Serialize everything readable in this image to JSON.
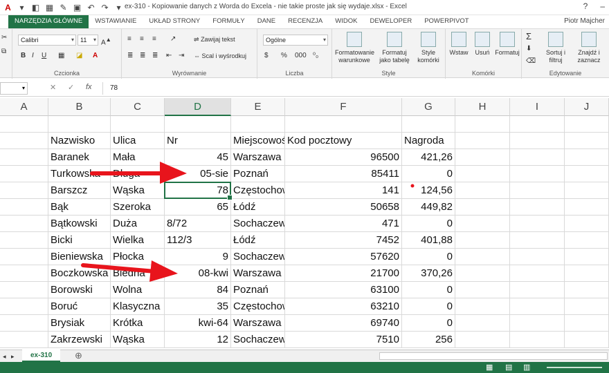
{
  "window": {
    "title": "ex-310 - Kopiowanie danych z Worda do Excela - nie takie proste jak się wydaje.xlsx - Excel",
    "user": "Piotr Majcher"
  },
  "tabs": [
    "NARZĘDZIA GŁÓWNE",
    "WSTAWIANIE",
    "UKŁAD STRONY",
    "FORMUŁY",
    "DANE",
    "RECENZJA",
    "WIDOK",
    "DEWELOPER",
    "POWERPIVOT"
  ],
  "ribbon": {
    "font_name": "Calibri",
    "font_size": "11",
    "number_format": "Ogólne",
    "wrap_text": "Zawijaj tekst",
    "merge_center": "Scal i wyśrodkuj",
    "cond_format": "Formatowanie warunkowe",
    "format_table": "Formatuj jako tabelę",
    "cell_styles": "Style komórki",
    "insert": "Wstaw",
    "delete": "Usuń",
    "format": "Formatuj",
    "sort_filter": "Sortuj i filtruj",
    "find_select": "Znajdź i zaznacz",
    "groups": {
      "font": "Czcionka",
      "alignment": "Wyrównanie",
      "number": "Liczba",
      "style": "Style",
      "cells": "Komórki",
      "editing": "Edytowanie"
    }
  },
  "formula_bar": {
    "value": "78"
  },
  "columns": [
    "A",
    "B",
    "C",
    "D",
    "E",
    "F",
    "G",
    "H",
    "I",
    "J"
  ],
  "headers": {
    "B": "Nazwisko",
    "C": "Ulica",
    "D": "Nr",
    "E": "Miejscowość",
    "F": "Kod pocztowy",
    "G": "Nagroda"
  },
  "rows": [
    [
      "Baranek",
      "Mała",
      "45",
      "Warszawa",
      "96500",
      "421,26"
    ],
    [
      "Turkowska",
      "Długa",
      "05-sie",
      "Poznań",
      "85411",
      "0"
    ],
    [
      "Barszcz",
      "Wąska",
      "78",
      "Częstochowa",
      "141",
      "124,56"
    ],
    [
      "Bąk",
      "Szeroka",
      "65",
      "Łódź",
      "50658",
      "449,82"
    ],
    [
      "Bątkowski",
      "Duża",
      "8/72",
      "Sochaczew",
      "471",
      "0"
    ],
    [
      "Bicki",
      "Wielka",
      "112/3",
      "Łódź",
      "7452",
      "401,88"
    ],
    [
      "Bieniewska",
      "Płocka",
      "9",
      "Sochaczew",
      "57620",
      "0"
    ],
    [
      "Boczkowska",
      "Biedna",
      "08-kwi",
      "Warszawa",
      "21700",
      "370,26"
    ],
    [
      "Borowski",
      "Wolna",
      "84",
      "Poznań",
      "63100",
      "0"
    ],
    [
      "Boruć",
      "Klasyczna",
      "35",
      "Częstochowa",
      "63210",
      "0"
    ],
    [
      "Brysiak",
      "Krótka",
      "kwi-64",
      "Warszawa",
      "69740",
      "0"
    ],
    [
      "Zakrzewski",
      "Wąska",
      "12",
      "Sochaczew",
      "7510",
      "256"
    ]
  ],
  "sheet_tab": "ex-310",
  "colors": {
    "accent": "#217346",
    "arrow": "#e8141c"
  }
}
